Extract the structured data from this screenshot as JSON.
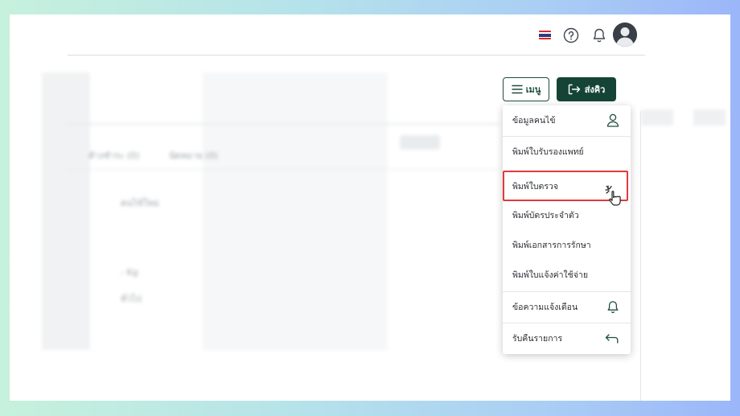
{
  "header": {
    "flag_icon": "thai-flag-icon",
    "help_icon": "help-circle-icon",
    "notifications_icon": "bell-icon",
    "avatar_icon": "user-avatar-icon"
  },
  "toolbar": {
    "menu_label": "เมนู",
    "menu_icon": "hamburger-icon",
    "send_label": "ส่งคิว",
    "send_icon": "exit-arrow-icon"
  },
  "background": {
    "tab_pending": "ค้างชำระ (0)",
    "tab_appointments": "นัดหมาย (0)",
    "new_patient": "คนไข้ใหม่",
    "weight": "- Kg",
    "general": "ทั่วไป"
  },
  "dropdown": {
    "items": [
      {
        "label": "ข้อมูลคนไข้",
        "icon": "person-icon"
      },
      {
        "label": "พิมพ์ใบรับรองแพทย์"
      },
      {
        "label": "พิมพ์ใบตรวจ"
      },
      {
        "label": "พิมพ์บัตรประจำตัว"
      },
      {
        "label": "พิมพ์เอกสารการรักษา"
      },
      {
        "label": "พิมพ์ใบแจ้งค่าใช้จ่าย"
      },
      {
        "label": "ข้อความแจ้งเตือน",
        "icon": "bell-icon"
      },
      {
        "label": "รับคืนรายการ",
        "icon": "return-arrow-icon"
      }
    ],
    "highlighted_index": 2
  },
  "colors": {
    "brand_dark_green": "#154437",
    "highlight_red": "#e0393f"
  }
}
